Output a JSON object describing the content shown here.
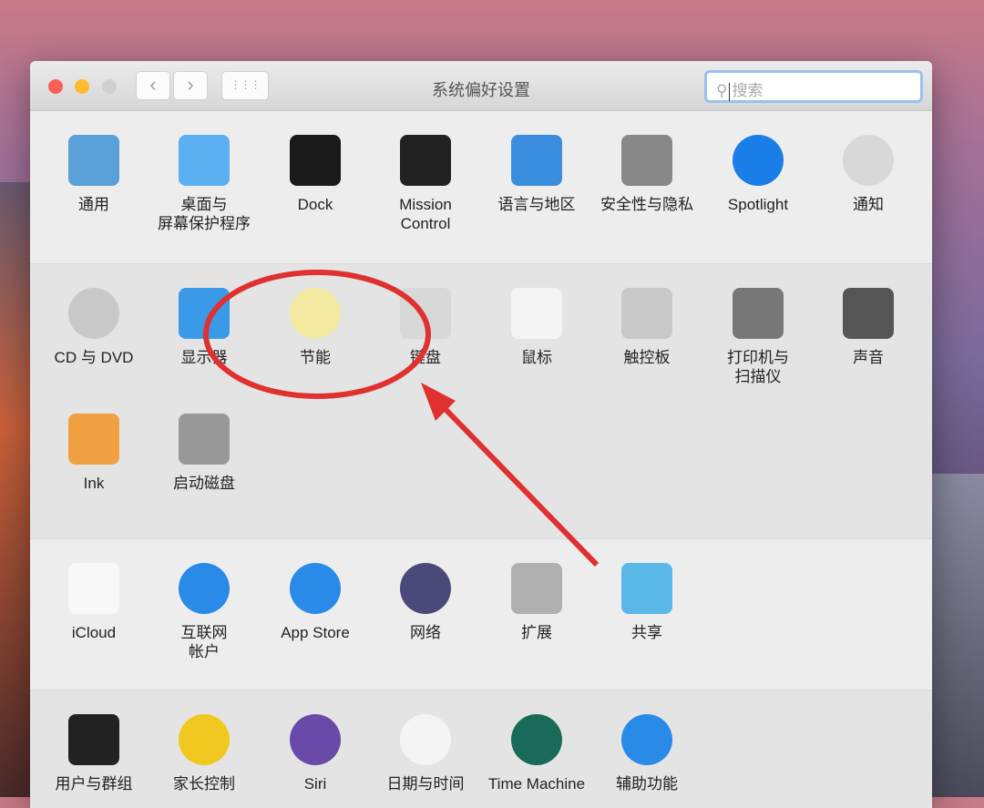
{
  "window": {
    "title": "系统偏好设置",
    "search_placeholder": "搜索",
    "back": "‹",
    "forward": "›",
    "grid": "⋮⋮⋮"
  },
  "sections": [
    {
      "items": [
        {
          "label": "通用",
          "icon": "general-icon",
          "color": "#5aa0d8"
        },
        {
          "label": "桌面与\n屏幕保护程序",
          "icon": "desktop-icon",
          "color": "#5ab0f0"
        },
        {
          "label": "Dock",
          "icon": "dock-icon",
          "color": "#1a1a1a"
        },
        {
          "label": "Mission\nControl",
          "icon": "mission-control-icon",
          "color": "#222222"
        },
        {
          "label": "语言与地区",
          "icon": "flag-icon",
          "color": "#3a8ee0"
        },
        {
          "label": "安全性与隐私",
          "icon": "security-house-icon",
          "color": "#888888"
        },
        {
          "label": "Spotlight",
          "icon": "spotlight-icon",
          "color": "#1a7ee8"
        },
        {
          "label": "通知",
          "icon": "notifications-icon",
          "color": "#d8d8d8"
        }
      ]
    },
    {
      "items": [
        {
          "label": "CD 与 DVD",
          "icon": "cd-icon",
          "color": "#c8c8c8"
        },
        {
          "label": "显示器",
          "icon": "display-icon",
          "color": "#3a9ae8"
        },
        {
          "label": "节能",
          "icon": "lightbulb-icon",
          "color": "#f4eaa0"
        },
        {
          "label": "键盘",
          "icon": "keyboard-icon",
          "color": "#d8d8d8"
        },
        {
          "label": "鼠标",
          "icon": "mouse-icon",
          "color": "#f4f4f4"
        },
        {
          "label": "触控板",
          "icon": "trackpad-icon",
          "color": "#c8c8c8"
        },
        {
          "label": "打印机与\n扫描仪",
          "icon": "printer-icon",
          "color": "#777777"
        },
        {
          "label": "声音",
          "icon": "speaker-icon",
          "color": "#555555"
        },
        {
          "label": "Ink",
          "icon": "ink-icon",
          "color": "#f0a040"
        },
        {
          "label": "启动磁盘",
          "icon": "disk-icon",
          "color": "#999999"
        }
      ]
    },
    {
      "items": [
        {
          "label": "iCloud",
          "icon": "icloud-icon",
          "color": "#f8f8f8"
        },
        {
          "label": "互联网\n帐户",
          "icon": "at-icon",
          "color": "#2a8ae8"
        },
        {
          "label": "App Store",
          "icon": "app-store-icon",
          "color": "#2a8ae8"
        },
        {
          "label": "网络",
          "icon": "network-globe-icon",
          "color": "#4a4a7a"
        },
        {
          "label": "扩展",
          "icon": "puzzle-icon",
          "color": "#b0b0b0"
        },
        {
          "label": "共享",
          "icon": "sharing-folder-icon",
          "color": "#5ab8e8"
        }
      ]
    },
    {
      "items": [
        {
          "label": "用户与群组",
          "icon": "users-icon",
          "color": "#222222"
        },
        {
          "label": "家长控制",
          "icon": "parental-controls-icon",
          "color": "#f0c820"
        },
        {
          "label": "Siri",
          "icon": "siri-icon",
          "color": "#6a4aa8"
        },
        {
          "label": "日期与时间",
          "icon": "clock-icon",
          "color": "#f4f4f4"
        },
        {
          "label": "Time Machine",
          "icon": "time-machine-icon",
          "color": "#1a6a5a"
        },
        {
          "label": "辅助功能",
          "icon": "accessibility-icon",
          "color": "#2a8ae8"
        }
      ]
    }
  ],
  "colors": {
    "annotation": "#e03030"
  }
}
